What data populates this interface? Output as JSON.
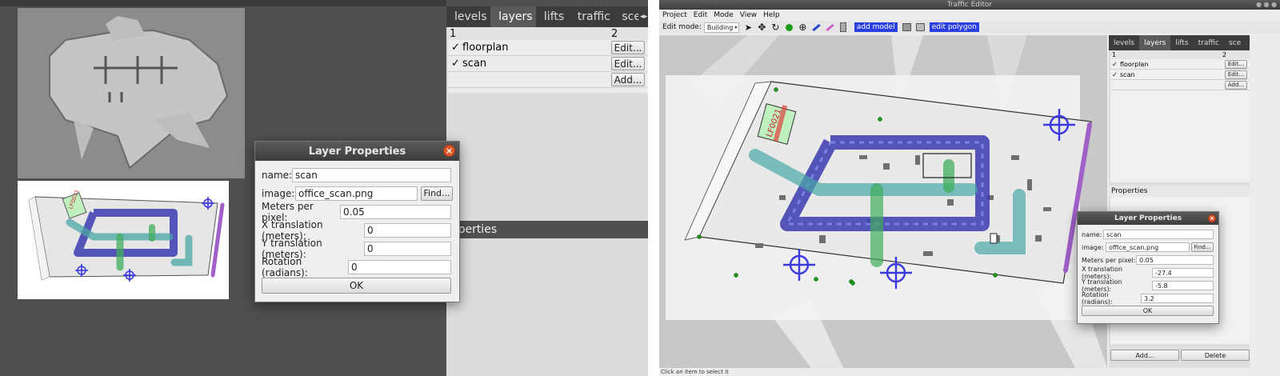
{
  "left": {
    "tabs": [
      {
        "label": "levels"
      },
      {
        "label": "layers"
      },
      {
        "label": "lifts"
      },
      {
        "label": "traffic"
      },
      {
        "label": "sce"
      }
    ],
    "layers_header": {
      "col1": "1",
      "col2": "2"
    },
    "layers": [
      {
        "check": "✓",
        "name": "floorplan",
        "button": "Edit..."
      },
      {
        "check": "✓",
        "name": "scan",
        "button": "Edit..."
      }
    ],
    "add_button": "Add...",
    "properties_header": "operties",
    "dialog": {
      "title": "Layer Properties",
      "close": "×",
      "name_label": "name:",
      "name_value": "scan",
      "image_label": "image:",
      "image_value": "office_scan.png",
      "find_button": "Find...",
      "mpp_label": "Meters per pixel:",
      "mpp_value": "0.05",
      "xt_label": "X translation (meters):",
      "xt_value": "0",
      "yt_label": "Y translation (meters):",
      "yt_value": "0",
      "rot_label": "Rotation (radians):",
      "rot_value": "0",
      "ok_button": "OK"
    },
    "map_label": "LF0021"
  },
  "right": {
    "window_title": "Traffic Editor",
    "menu": [
      {
        "label": "Project"
      },
      {
        "label": "Edit"
      },
      {
        "label": "Mode"
      },
      {
        "label": "View"
      },
      {
        "label": "Help"
      }
    ],
    "edit_mode_label": "Edit mode:",
    "edit_mode_value": "Building",
    "add_model_button": "add model",
    "edit_polygon_button": "edit polygon",
    "tabs": [
      {
        "label": "levels"
      },
      {
        "label": "layers"
      },
      {
        "label": "lifts"
      },
      {
        "label": "traffic"
      },
      {
        "label": "sce"
      }
    ],
    "layers_header": {
      "col1": "1",
      "col2": "2"
    },
    "layers": [
      {
        "check": "✓",
        "name": "floorplan",
        "button": "Edit..."
      },
      {
        "check": "✓",
        "name": "scan",
        "button": "Edit..."
      }
    ],
    "add_button": "Add...",
    "properties_header": "Properties",
    "bottom_add_button": "Add...",
    "bottom_delete_button": "Delete",
    "status_text": "Click an item to select it",
    "dialog": {
      "title": "Layer Properties",
      "close": "×",
      "name_label": "name:",
      "name_value": "scan",
      "image_label": "image:",
      "image_value": "office_scan.png",
      "find_button": "Find...",
      "mpp_label": "Meters per pixel:",
      "mpp_value": "0.05",
      "xt_label": "X translation (meters):",
      "xt_value": "-27.4",
      "yt_label": "Y translation (meters):",
      "yt_value": "-5.8",
      "rot_label": "Rotation (radians):",
      "rot_value": "3.2",
      "ok_button": "OK"
    },
    "map_label": "LF0021"
  },
  "colors": {
    "lane_blue": "#3a3ab0",
    "lane_teal": "#4aa6a6",
    "lane_green": "#3fae5a",
    "wall_purple": "#a060c8",
    "charger_blue": "#3a3ae0"
  }
}
